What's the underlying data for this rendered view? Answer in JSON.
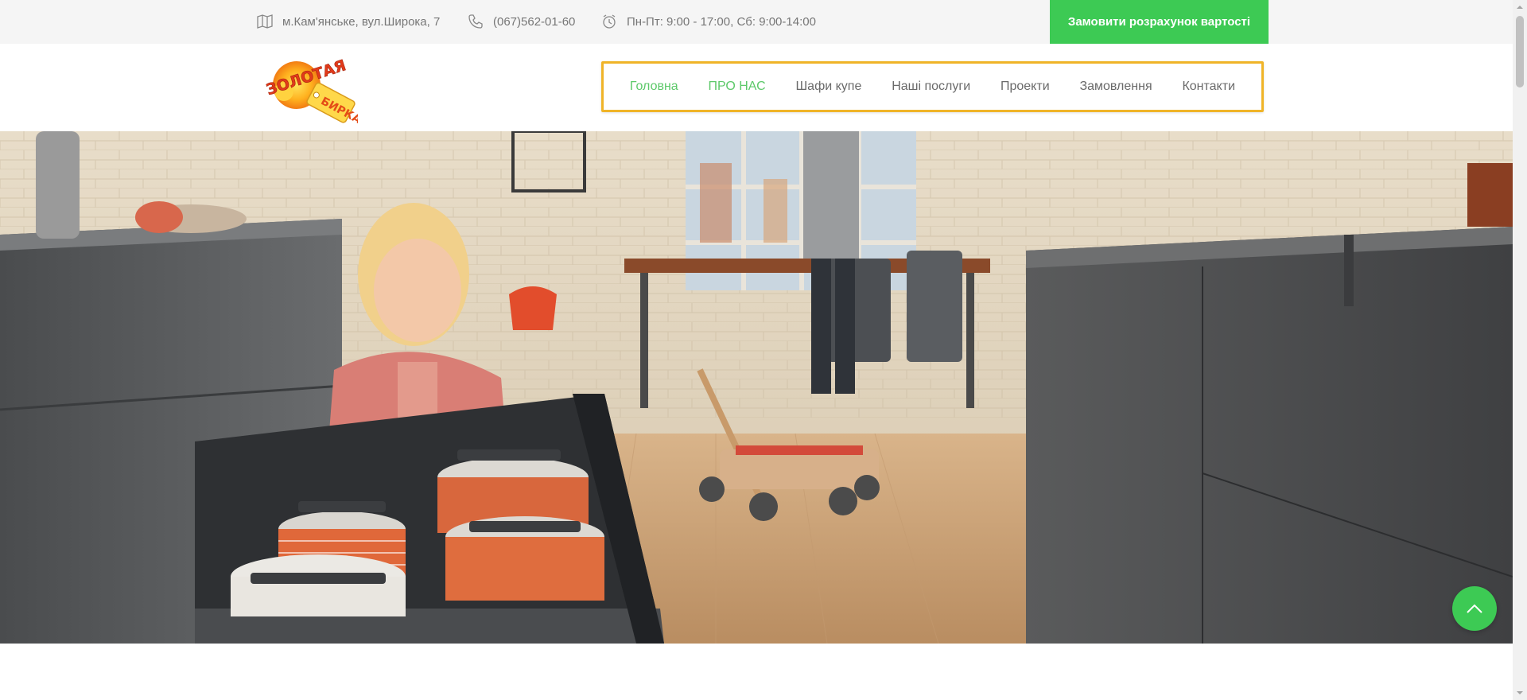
{
  "topbar": {
    "address": "м.Кам'янське, вул.Широка, 7",
    "phone": "(067)562-01-60",
    "hours": "Пн-Пт: 9:00 - 17:00, Сб: 9:00-14:00",
    "cta_label": "Замовити розрахунок вартості",
    "icons": {
      "address": "map-icon",
      "phone": "phone-icon",
      "hours": "alarm-clock-icon"
    }
  },
  "logo": {
    "alt": "Золотая бирка",
    "line1": "ЗОЛОТАЯ",
    "line2": "БИРКА"
  },
  "nav": {
    "items": [
      {
        "label": "Головна",
        "active": true
      },
      {
        "label": "ПРО НАС",
        "active": true
      },
      {
        "label": "Шафи купе",
        "active": false
      },
      {
        "label": "Наші послуги",
        "active": false
      },
      {
        "label": "Проекти",
        "active": false
      },
      {
        "label": "Замовлення",
        "active": false
      },
      {
        "label": "Контакти",
        "active": false
      }
    ]
  },
  "back_to_top": {
    "icon": "chevron-up-icon"
  },
  "colors": {
    "accent": "#3dca54",
    "nav_active": "#5dc96a",
    "nav_highlight_border": "#f0b428",
    "topbar_bg": "#f5f5f5"
  }
}
